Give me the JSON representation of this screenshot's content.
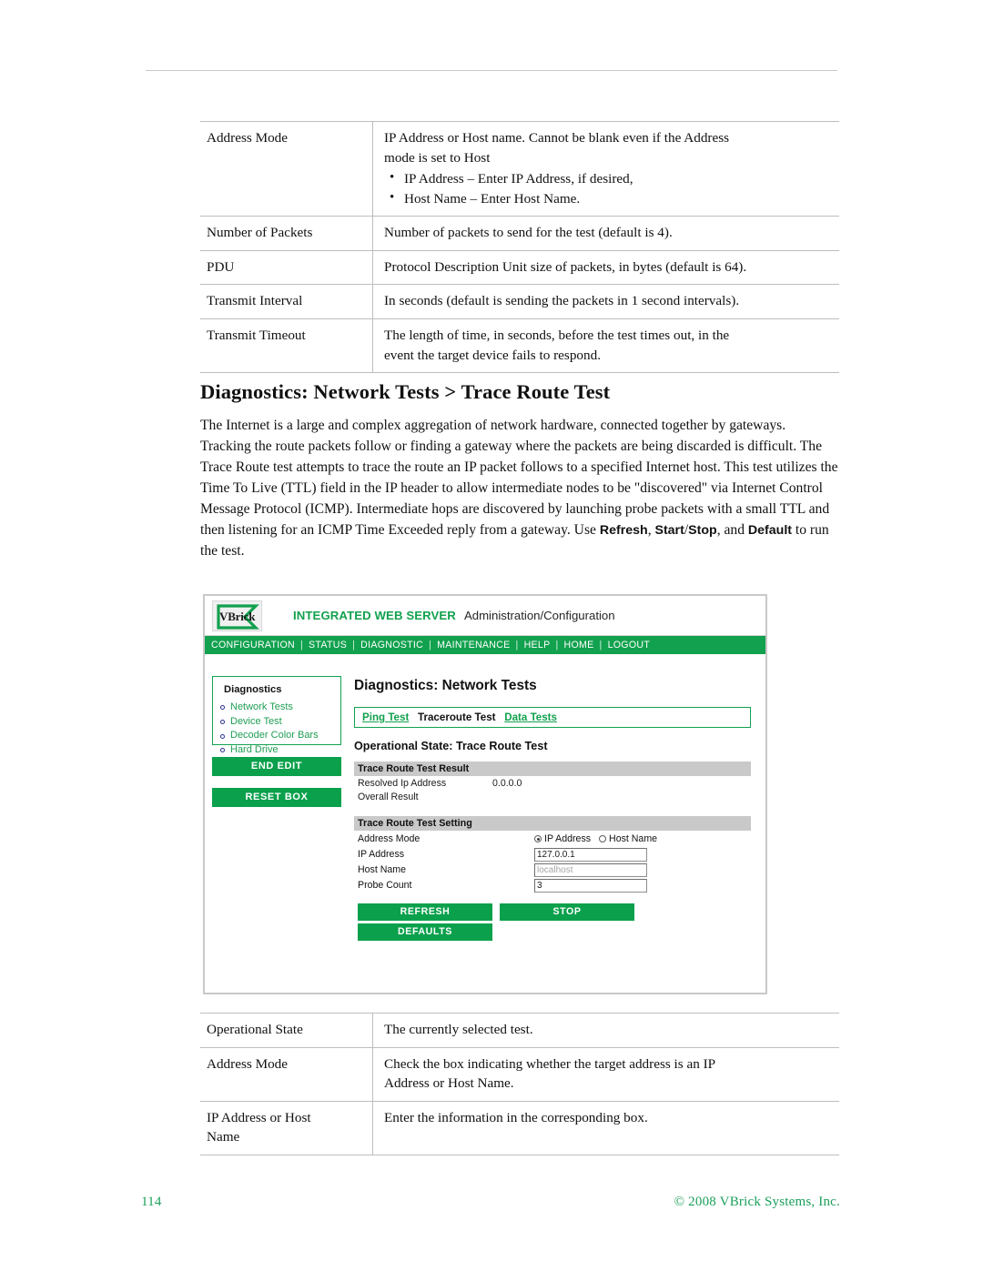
{
  "footer": {
    "page_number": "114",
    "copyright": "© 2008 VBrick Systems, Inc."
  },
  "section": {
    "heading": "Diagnostics: Network Tests > Trace Route Test",
    "paragraph_1": "The Internet is a large and complex aggregation of network hardware, connected together by gateways. Tracking the route packets follow or finding a gateway where the packets are being discarded is difficult. The Trace Route test attempts to trace the route an IP packet follows to a specified Internet host. This test utilizes the Time To Live (TTL) field in the IP header to allow intermediate nodes to be \"discovered\" via Internet Control Message Protocol (ICMP). Intermediate hops are discovered by launching probe packets with a small TTL and then listening for an ICMP Time Exceeded reply from a gateway. Use ",
    "paragraph_bold_1": "Refresh",
    "paragraph_mid_1": ", ",
    "paragraph_bold_2": "Start",
    "paragraph_mid_2": "/",
    "paragraph_bold_3": "Stop",
    "paragraph_mid_3": ", and ",
    "paragraph_bold_4": "Default",
    "paragraph_end": " to run the test."
  },
  "table_top": {
    "rows": [
      {
        "label": "Address Mode",
        "desc_line1": "IP Address or Host name. Cannot be blank even if the Address",
        "desc_line2": "mode is set to Host",
        "bullets": [
          "IP Address – Enter IP Address, if desired,",
          "Host Name – Enter Host Name."
        ]
      },
      {
        "label": "Number of Packets",
        "desc_line1": "Number of packets to send for the test (default is 4).",
        "desc_line2": "",
        "bullets": []
      },
      {
        "label": "PDU",
        "desc_line1": "Protocol Description Unit size of packets, in bytes (default is 64).",
        "desc_line2": "",
        "bullets": []
      },
      {
        "label": "Transmit Interval",
        "desc_line1": "In seconds (default is sending the packets in 1 second intervals).",
        "desc_line2": "",
        "bullets": []
      },
      {
        "label": "Transmit Timeout",
        "desc_line1": "The length of time, in seconds, before the test times out, in the",
        "desc_line2": "event the target device fails to respond.",
        "bullets": []
      }
    ]
  },
  "table_bottom": {
    "rows": [
      {
        "label": "Operational State",
        "desc_line1": "The currently selected test.",
        "desc_line2": ""
      },
      {
        "label": "Address Mode",
        "desc_line1": " Check the box indicating whether the target address is an IP",
        "desc_line2": "Address or Host Name."
      },
      {
        "label_line1": "IP Address or Host",
        "label_line2": "Name",
        "label": "IP Address or Host Name",
        "desc_line1": "Enter the information in the corresponding box.",
        "desc_line2": ""
      }
    ]
  },
  "screenshot": {
    "header": {
      "logo_text": "VBrick",
      "product": "INTEGRATED WEB SERVER",
      "subtitle": "Administration/Configuration"
    },
    "nav": [
      "CONFIGURATION",
      "STATUS",
      "DIAGNOSTIC",
      "MAINTENANCE",
      "HELP",
      "HOME",
      "LOGOUT"
    ],
    "nav_separator": "|",
    "sidebar": {
      "title": "Diagnostics",
      "items": [
        "Network Tests",
        "Device Test",
        "Decoder Color Bars",
        "Hard Drive"
      ],
      "end_edit_label": "END EDIT",
      "reset_box_label": "RESET BOX"
    },
    "main": {
      "page_title": "Diagnostics: Network Tests",
      "tabs": [
        {
          "label": "Ping Test",
          "style": "link"
        },
        {
          "label": "Traceroute Test",
          "style": "current"
        },
        {
          "label": "Data Tests",
          "style": "link"
        }
      ],
      "operational_state": "Operational State: Trace Route Test",
      "result_section": {
        "header": "Trace Route Test Result",
        "rows": [
          {
            "key": "Resolved Ip Address",
            "value": "0.0.0.0"
          },
          {
            "key": "Overall Result",
            "value": ""
          }
        ]
      },
      "setting_section": {
        "header": "Trace Route Test Setting",
        "address_mode_label": "Address Mode",
        "radio_ip_label": "IP Address",
        "radio_host_label": "Host Name",
        "radio_selected": "IP Address",
        "ip_address_label": "IP Address",
        "ip_address_value": "127.0.0.1",
        "host_name_label": "Host Name",
        "host_name_value": "localhost",
        "probe_count_label": "Probe Count",
        "probe_count_value": "3"
      },
      "buttons": {
        "refresh": "REFRESH",
        "stop": "STOP",
        "defaults": "DEFAULTS"
      }
    }
  },
  "colors": {
    "brand_green": "#12a14e",
    "button_green": "#0aa04c",
    "gray_header": "#c9c9c9",
    "footer_green": "#1aa05a"
  }
}
